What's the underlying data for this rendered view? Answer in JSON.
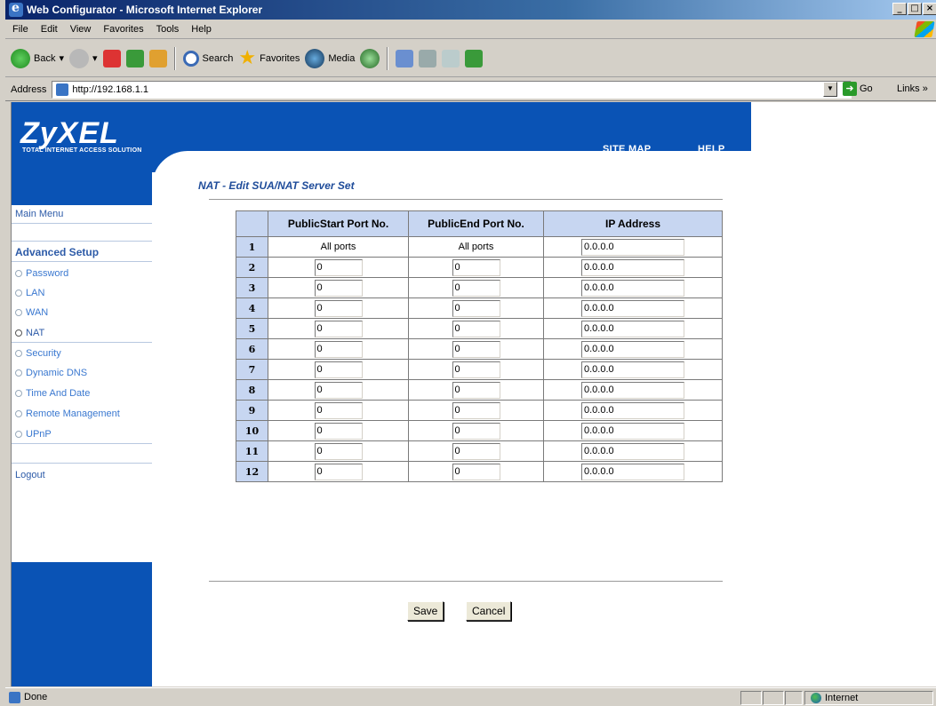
{
  "window": {
    "title": "Web Configurator - Microsoft Internet Explorer"
  },
  "menu": [
    "File",
    "Edit",
    "View",
    "Favorites",
    "Tools",
    "Help"
  ],
  "toolbar": {
    "back": "Back",
    "search": "Search",
    "favorites": "Favorites",
    "media": "Media"
  },
  "address": {
    "label": "Address",
    "url": "http://192.168.1.1",
    "go": "Go",
    "links": "Links"
  },
  "header": {
    "logo": "ZyXEL",
    "tagline": "TOTAL INTERNET ACCESS SOLUTION",
    "site_map": "SITE MAP",
    "help": "HELP"
  },
  "sidebar": {
    "main_menu": "Main Menu",
    "advanced_setup": "Advanced Setup",
    "items": [
      "Password",
      "LAN",
      "WAN",
      "NAT",
      "Security",
      "Dynamic DNS",
      "Time And Date",
      "Remote Management",
      "UPnP"
    ],
    "active": "NAT",
    "logout": "Logout"
  },
  "page": {
    "title": "NAT - Edit SUA/NAT Server Set"
  },
  "table": {
    "headers": [
      "PublicStart Port No.",
      "PublicEnd Port No.",
      "IP Address"
    ],
    "rows": [
      {
        "num": "1",
        "start": "All ports",
        "end": "All ports",
        "ip": "0.0.0.0"
      },
      {
        "num": "2",
        "start": "0",
        "end": "0",
        "ip": "0.0.0.0"
      },
      {
        "num": "3",
        "start": "0",
        "end": "0",
        "ip": "0.0.0.0"
      },
      {
        "num": "4",
        "start": "0",
        "end": "0",
        "ip": "0.0.0.0"
      },
      {
        "num": "5",
        "start": "0",
        "end": "0",
        "ip": "0.0.0.0"
      },
      {
        "num": "6",
        "start": "0",
        "end": "0",
        "ip": "0.0.0.0"
      },
      {
        "num": "7",
        "start": "0",
        "end": "0",
        "ip": "0.0.0.0"
      },
      {
        "num": "8",
        "start": "0",
        "end": "0",
        "ip": "0.0.0.0"
      },
      {
        "num": "9",
        "start": "0",
        "end": "0",
        "ip": "0.0.0.0"
      },
      {
        "num": "10",
        "start": "0",
        "end": "0",
        "ip": "0.0.0.0"
      },
      {
        "num": "11",
        "start": "0",
        "end": "0",
        "ip": "0.0.0.0"
      },
      {
        "num": "12",
        "start": "0",
        "end": "0",
        "ip": "0.0.0.0"
      }
    ]
  },
  "buttons": {
    "save": "Save",
    "cancel": "Cancel"
  },
  "status": {
    "left": "Done",
    "zone": "Internet"
  }
}
